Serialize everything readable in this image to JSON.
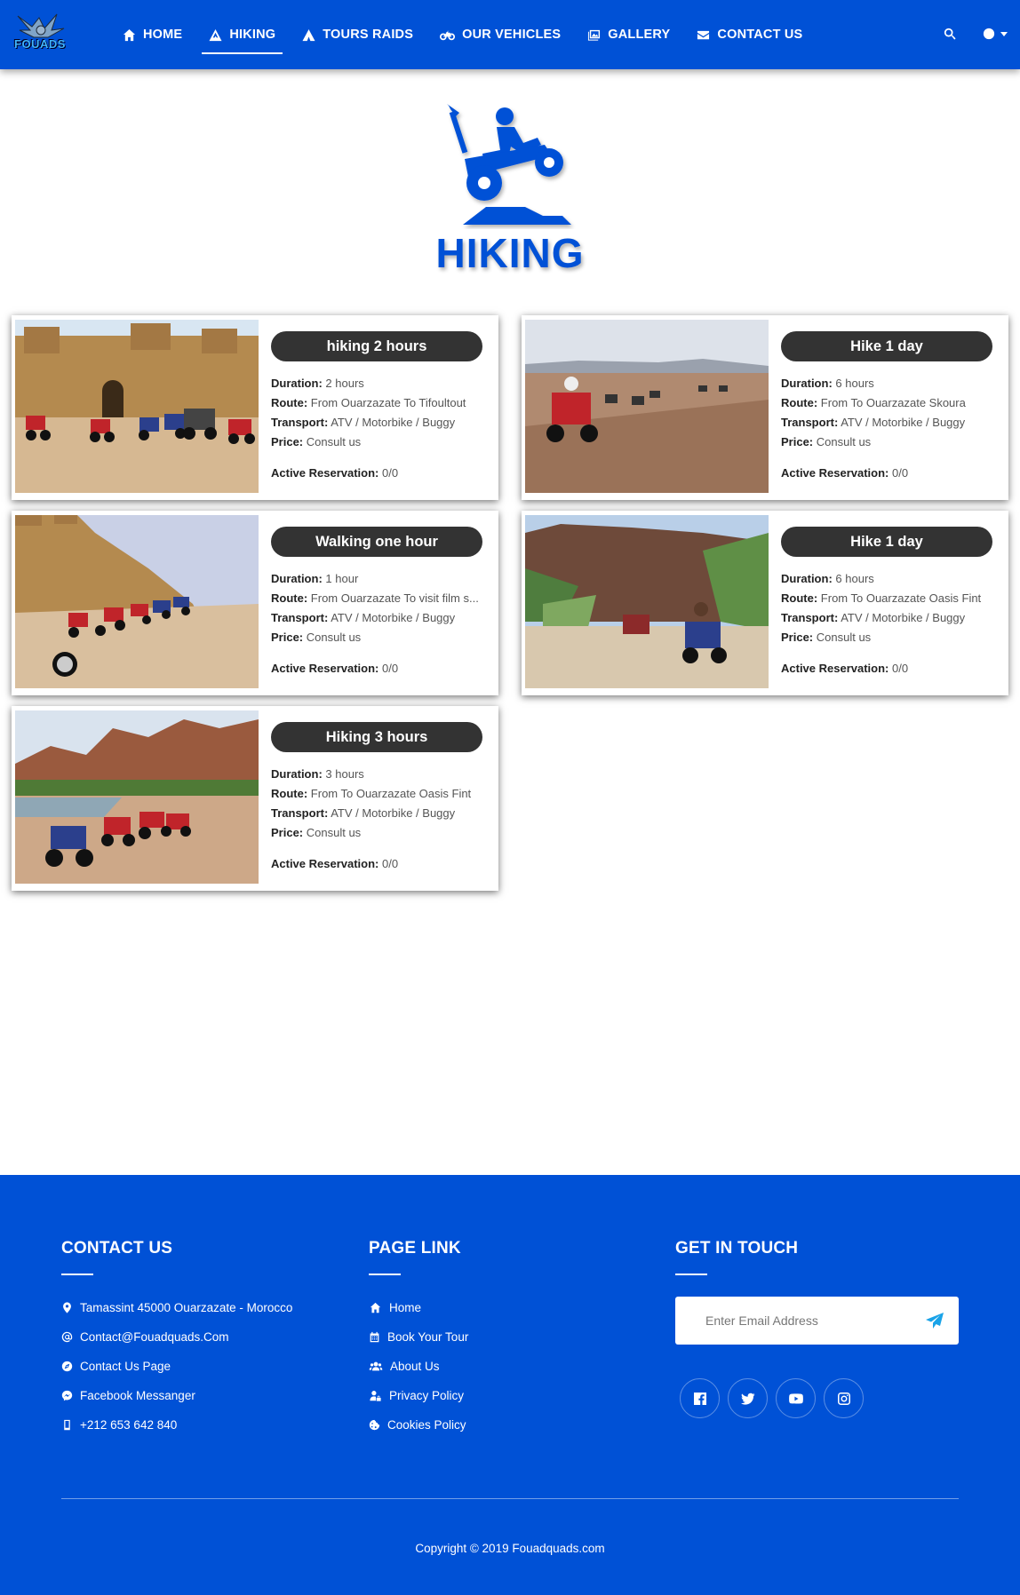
{
  "brand": {
    "logo_text": "FOUADS"
  },
  "nav": {
    "items": [
      {
        "label": "HOME",
        "icon": "home-icon"
      },
      {
        "label": "HIKING",
        "icon": "mountain-icon",
        "active": true
      },
      {
        "label": "TOURS RAIDS",
        "icon": "tent-icon"
      },
      {
        "label": "OUR VEHICLES",
        "icon": "motorcycle-icon"
      },
      {
        "label": "GALLERY",
        "icon": "images-icon"
      },
      {
        "label": "CONTACT US",
        "icon": "envelope-icon"
      }
    ],
    "right_icons": [
      "search-icon",
      "globe-icon"
    ]
  },
  "hero": {
    "title": "HIKING",
    "icon": "atv-rider-icon"
  },
  "labels": {
    "duration": "Duration:",
    "route": "Route:",
    "transport": "Transport:",
    "price": "Price:",
    "reservation": "Active Reservation:"
  },
  "tours": [
    {
      "title": "hiking 2 hours",
      "duration": "2 hours",
      "route": "From Ouarzazate To Tifoultout",
      "transport": "ATV / Motorbike / Buggy",
      "price": "Consult us",
      "reservation": "0/0"
    },
    {
      "title": "Hike 1 day",
      "duration": "6 hours",
      "route": "From To Ouarzazate Skoura",
      "transport": "ATV / Motorbike / Buggy",
      "price": "Consult us",
      "reservation": "0/0"
    },
    {
      "title": "Walking one hour",
      "duration": "1 hour",
      "route": "From Ouarzazate To visit film s...",
      "transport": "ATV / Motorbike / Buggy",
      "price": "Consult us",
      "reservation": "0/0"
    },
    {
      "title": "Hike 1 day",
      "duration": "6 hours",
      "route": "From To Ouarzazate Oasis Fint",
      "transport": "ATV / Motorbike / Buggy",
      "price": "Consult us",
      "reservation": "0/0"
    },
    {
      "title": "Hiking 3 hours",
      "duration": "3 hours",
      "route": "From To Ouarzazate Oasis Fint",
      "transport": "ATV / Motorbike / Buggy",
      "price": "Consult us",
      "reservation": "0/0"
    }
  ],
  "footer": {
    "contact": {
      "title": "CONTACT US",
      "items": [
        {
          "icon": "map-marker-icon",
          "text": "Tamassint 45000 Ouarzazate - Morocco"
        },
        {
          "icon": "at-icon",
          "text": "Contact@Fouadquads.Com"
        },
        {
          "icon": "compass-icon",
          "text": "Contact Us Page"
        },
        {
          "icon": "messenger-icon",
          "text": "Facebook Messanger"
        },
        {
          "icon": "mobile-icon",
          "text": "+212 653 642 840"
        }
      ]
    },
    "pages": {
      "title": "PAGE LINK",
      "items": [
        {
          "icon": "home-icon",
          "text": "Home"
        },
        {
          "icon": "calendar-icon",
          "text": "Book Your Tour"
        },
        {
          "icon": "users-icon",
          "text": "About Us"
        },
        {
          "icon": "user-lock-icon",
          "text": "Privacy Policy"
        },
        {
          "icon": "cookie-icon",
          "text": "Cookies Policy"
        }
      ]
    },
    "touch": {
      "title": "GET IN TOUCH",
      "email_placeholder": "Enter Email Address",
      "socials": [
        "facebook-icon",
        "twitter-icon",
        "youtube-icon",
        "instagram-icon"
      ]
    },
    "copyright": "Copyright © 2019 Fouadquads.com"
  },
  "colors": {
    "primary": "#0051d6",
    "pill": "#333333",
    "send_icon": "#1aa3e8"
  }
}
